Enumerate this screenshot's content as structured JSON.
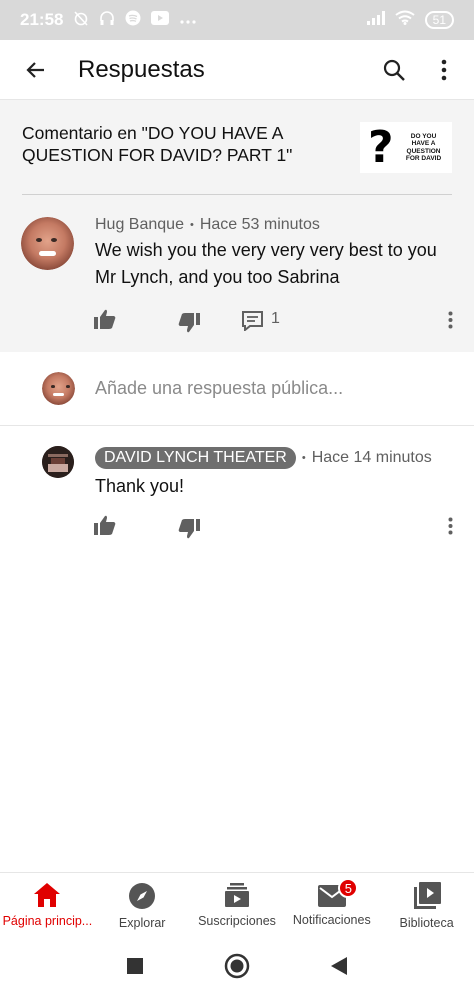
{
  "status_bar": {
    "time": "21:58",
    "battery": "51"
  },
  "app_bar": {
    "title": "Respuestas"
  },
  "context": {
    "title": "Comentario en \"DO YOU HAVE A QUESTION FOR DAVID? PART 1\"",
    "thumbnail_mark": "?",
    "thumbnail_text": "DO YOU HAVE A QUESTION FOR DAVID"
  },
  "parent_comment": {
    "author": "Hug Banque",
    "separator": "•",
    "time": "Hace 53 minutos",
    "text": "We wish you the very very very best to you Mr Lynch, and you too Sabrina",
    "reply_count": "1"
  },
  "reply_box": {
    "placeholder": "Añade una respuesta pública..."
  },
  "reply": {
    "author": "DAVID LYNCH THEATER",
    "separator": "•",
    "time": "Hace 14 minutos",
    "text": "Thank you!"
  },
  "bottom_nav": {
    "items": [
      {
        "label": "Página princip...",
        "icon": "home-icon",
        "active": true
      },
      {
        "label": "Explorar",
        "icon": "compass-icon"
      },
      {
        "label": "Suscripciones",
        "icon": "subscriptions-icon"
      },
      {
        "label": "Notificaciones",
        "icon": "mail-icon",
        "badge": "5"
      },
      {
        "label": "Biblioteca",
        "icon": "library-icon"
      }
    ]
  },
  "colors": {
    "accent": "#e00000",
    "chip": "#6e6e6e",
    "context_bg": "#f4f4f4"
  }
}
